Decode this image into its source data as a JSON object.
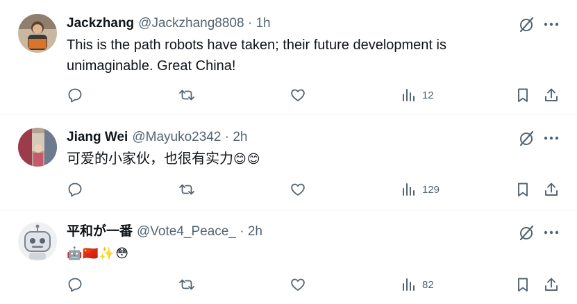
{
  "tweets": [
    {
      "name": "Jackzhang",
      "handle": "@Jackzhang8808",
      "separator": "·",
      "time": "1h",
      "text_line1": "This is the path robots have taken; their future development is",
      "text_line2": "unimaginable. Great China!",
      "views": "12",
      "avatar_icon": "person-holding-sign-avatar"
    },
    {
      "name": "Jiang Wei",
      "handle": "@Mayuko2342",
      "separator": "·",
      "time": "2h",
      "text": "可爱的小家伙，也很有实力",
      "emoji": "😊😊",
      "views": "129",
      "avatar_icon": "room-photo-avatar"
    },
    {
      "name": "平和が一番",
      "handle": "@Vote4_Peace_",
      "separator": "·",
      "time": "2h",
      "emoji": "🤖🇨🇳✨😳",
      "views": "82",
      "avatar_icon": "robot-cartoon-avatar"
    }
  ],
  "colors": {
    "icon_gray": "#536471",
    "text": "#0f1419",
    "divider": "#eff3f4"
  }
}
